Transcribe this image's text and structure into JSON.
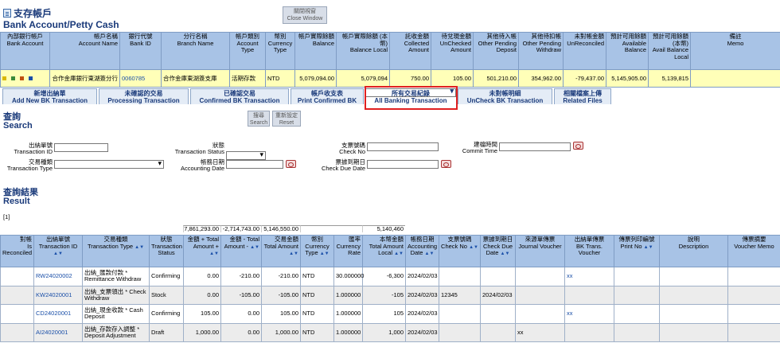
{
  "header": {
    "title_cn": "支存帳戶",
    "title_en": "Bank Account/Petty Cash",
    "close_cn": "關閉視窗",
    "close_en": "Close Window"
  },
  "account_table": {
    "headers": [
      {
        "cn": "內部銀行帳戶",
        "en": "Bank Account"
      },
      {
        "cn": "帳戶名稱",
        "en": "Account Name"
      },
      {
        "cn": "銀行代號",
        "en": "Bank ID"
      },
      {
        "cn": "分行名稱",
        "en": "Branch Name"
      },
      {
        "cn": "帳戶類別",
        "en": "Account Type"
      },
      {
        "cn": "幣別",
        "en": "Currency Type"
      },
      {
        "cn": "帳戶實際餘額",
        "en": "Balance"
      },
      {
        "cn": "帳戶實際餘額 (本幣)",
        "en": "Balance Local"
      },
      {
        "cn": "託收金額",
        "en": "Collected Amount"
      },
      {
        "cn": "待兌現金額",
        "en": "UnChecked Amount"
      },
      {
        "cn": "其他待入帳",
        "en": "Other Pending Deposit"
      },
      {
        "cn": "其他待扣帳",
        "en": "Other Pending Withdraw"
      },
      {
        "cn": "未對帳金額",
        "en": "UnReconciled"
      },
      {
        "cn": "預計可用餘額",
        "en": "Available Balance"
      },
      {
        "cn": "預計可用餘額 (本幣)",
        "en": "Avail Balance Local"
      },
      {
        "cn": "備註",
        "en": "Memo"
      }
    ],
    "row": {
      "account_name": "合作金庫銀行東湖簽分行",
      "bank_id": "0060785",
      "branch_name": "合作金庫東湖簽支庫",
      "account_type": "活期存款",
      "currency": "NTD",
      "balance": "5,079,094.00",
      "balance_local": "5,079,094",
      "collected": "750.00",
      "unchecked": "105.00",
      "other_deposit": "501,210.00",
      "other_withdraw": "354,962.00",
      "unreconciled": "-79,437.00",
      "available": "5,145,905.00",
      "available_local": "5,139,815",
      "memo": ""
    },
    "icon_colors": [
      "#d9b800",
      "#3a8a3a",
      "#c05010",
      "#1a4fa8"
    ]
  },
  "tabs": [
    {
      "cn": "新增出納單",
      "en": "Add New BK Transaction"
    },
    {
      "cn": "未確認的交易",
      "en": "Processing Transaction"
    },
    {
      "cn": "已確認交易",
      "en": "Confirmed BK Transaction"
    },
    {
      "cn": "帳戶收支表",
      "en": "Print Confirmed BK"
    },
    {
      "cn": "所有交易紀錄",
      "en": "All Banking Transaction"
    },
    {
      "cn": "未對帳明細",
      "en": "UnCheck BK Transaction"
    },
    {
      "cn": "相關檔案上傳",
      "en": "Related Files"
    }
  ],
  "search": {
    "title_cn": "查詢",
    "title_en": "Search",
    "search_btn_cn": "搜尋",
    "search_btn_en": "Search",
    "reset_btn_cn": "重新設定",
    "reset_btn_en": "Reset",
    "fields": {
      "transaction_id": {
        "cn": "出納單號",
        "en": "Transaction ID"
      },
      "transaction_type": {
        "cn": "交易種類",
        "en": "Transaction Type"
      },
      "transaction_status": {
        "cn": "狀態",
        "en": "Transaction Status"
      },
      "accounting_date": {
        "cn": "帳務日期",
        "en": "Accounting Date"
      },
      "check_no": {
        "cn": "支票號碼",
        "en": "Check No"
      },
      "check_due_date": {
        "cn": "票據到期日",
        "en": "Check Due Date"
      },
      "commit_time": {
        "cn": "建檔時間",
        "en": "Commit Time"
      }
    }
  },
  "result": {
    "title_cn": "查詢結果",
    "title_en": "Result",
    "pager": "[1]",
    "totals": {
      "total_amount_plus": "7,861,293.00",
      "total_amount_minus": "-2,714,743.00",
      "transaction_amount": "5,146,550.00",
      "local_amount": "5,140,460"
    },
    "headers": [
      {
        "cn": "對帳",
        "en": "Is Reconciled"
      },
      {
        "cn": "出納單號",
        "en": "Transaction ID"
      },
      {
        "cn": "交易種類",
        "en": "Transaction Type"
      },
      {
        "cn": "狀態",
        "en": "Transaction Status"
      },
      {
        "cn": "金額 + Total",
        "en": "Amount +"
      },
      {
        "cn": "金額 - Total",
        "en": "Amount -"
      },
      {
        "cn": "交易金額",
        "en": "Total Amount"
      },
      {
        "cn": "幣別",
        "en": "Currency Type"
      },
      {
        "cn": "匯率",
        "en": "Currency Rate"
      },
      {
        "cn": "本幣金額",
        "en": "Total Amount Local"
      },
      {
        "cn": "帳務日期",
        "en": "Accounting Date"
      },
      {
        "cn": "支票號碼",
        "en": "Check No"
      },
      {
        "cn": "票據到期日",
        "en": "Check Due Date"
      },
      {
        "cn": "來源單傳票",
        "en": "Journal Voucher"
      },
      {
        "cn": "出納單傳票",
        "en": "BK Trans. Voucher"
      },
      {
        "cn": "傳票列印編號",
        "en": "Print No"
      },
      {
        "cn": "說明",
        "en": "Description"
      },
      {
        "cn": "傳票摘要",
        "en": "Voucher Memo"
      }
    ],
    "rows": [
      {
        "id": "RW24020002",
        "type_cn": "出納_匯款付款 *",
        "type_en": "Remittance Withdraw",
        "status": "Confirming",
        "plus": "0.00",
        "minus": "-210.00",
        "amount": "-210.00",
        "currency": "NTD",
        "rate": "30.000000",
        "local": "-6,300",
        "date": "2024/02/03",
        "check_no": "",
        "due": "",
        "jv": "",
        "bkv": "xx",
        "print_no": "",
        "desc": "",
        "memo": ""
      },
      {
        "id": "KW24020001",
        "type_cn": "出納_支票領出 * Check",
        "type_en": "Withdraw",
        "status": "Stock",
        "plus": "0.00",
        "minus": "-105.00",
        "amount": "-105.00",
        "currency": "NTD",
        "rate": "1.000000",
        "local": "-105",
        "date": "2024/02/03",
        "check_no": "12345",
        "due": "2024/02/03",
        "jv": "",
        "bkv": "",
        "print_no": "",
        "desc": "",
        "memo": ""
      },
      {
        "id": "CD24020001",
        "type_cn": "出納_現金收款 * Cash",
        "type_en": "Deposit",
        "status": "Confirming",
        "plus": "105.00",
        "minus": "0.00",
        "amount": "105.00",
        "currency": "NTD",
        "rate": "1.000000",
        "local": "105",
        "date": "2024/02/03",
        "check_no": "",
        "due": "",
        "jv": "",
        "bkv": "xx",
        "print_no": "",
        "desc": "",
        "memo": ""
      },
      {
        "id": "AI24020001",
        "type_cn": "出納_存款存入調整 *",
        "type_en": "Deposit Adjustment",
        "status": "Draft",
        "plus": "1,000.00",
        "minus": "0.00",
        "amount": "1,000.00",
        "currency": "NTD",
        "rate": "1.000000",
        "local": "1,000",
        "date": "2024/02/03",
        "check_no": "",
        "due": "",
        "jv": "xx",
        "bkv": "",
        "print_no": "",
        "desc": "",
        "memo": ""
      }
    ]
  },
  "colors": {
    "header_bg": "#a8c3e6",
    "account_row_bg": "#ffffb8",
    "title_color": "#1a3a7a",
    "link_color": "#1a4fa8",
    "highlight_border": "#e02020"
  }
}
